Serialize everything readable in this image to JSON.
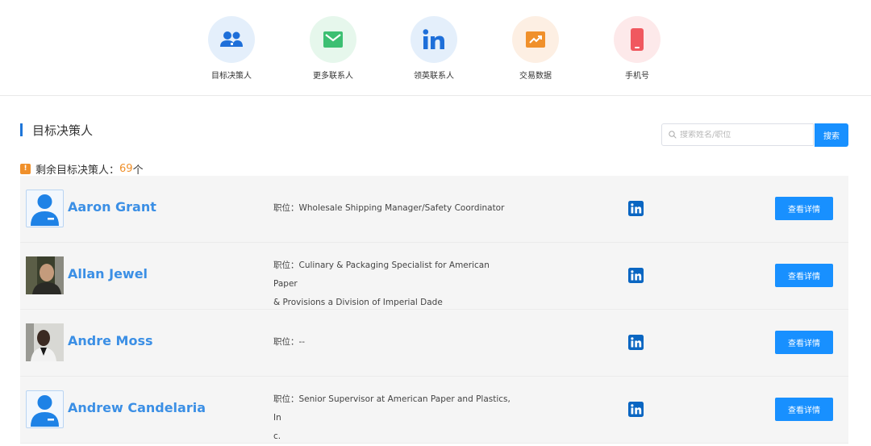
{
  "nav": {
    "items": [
      {
        "label": "目标决策人",
        "icon": "people-icon",
        "bg": "#e4effb"
      },
      {
        "label": "更多联系人",
        "icon": "mail-icon",
        "bg": "#e6f7ec"
      },
      {
        "label": "领英联系人",
        "icon": "linkedin-icon",
        "bg": "#e4effb"
      },
      {
        "label": "交易数据",
        "icon": "trend-chart-icon",
        "bg": "#fdefe3"
      },
      {
        "label": "手机号",
        "icon": "phone-icon",
        "bg": "#fde9ea"
      }
    ]
  },
  "section": {
    "title": "目标决策人"
  },
  "search": {
    "placeholder": "搜索姓名/职位",
    "button": "搜索"
  },
  "remaining": {
    "label": "剩余目标决策人：",
    "count": "69",
    "unit": "个"
  },
  "colors": {
    "accent": "#1890ff",
    "name": "#3b8fe5",
    "count": "#f0902b",
    "linkedin": "#0a66c2"
  },
  "people": [
    {
      "name": "Aaron Grant",
      "title_prefix": "职位：",
      "title": "Wholesale Shipping Manager/Safety Coordinator",
      "title_line2": "",
      "avatar": "default-avatar-icon",
      "button": "查看详情"
    },
    {
      "name": "Allan Jewel",
      "title_prefix": "职位：",
      "title": "Culinary & Packaging Specialist for American Paper",
      "title_line2": "& Provisions a Division of Imperial Dade",
      "avatar": "photo",
      "button": "查看详情"
    },
    {
      "name": "Andre Moss",
      "title_prefix": "职位：",
      "title": "--",
      "title_line2": "",
      "avatar": "photo",
      "button": "查看详情"
    },
    {
      "name": "Andrew Candelaria",
      "title_prefix": "职位：",
      "title": "Senior Supervisor at American Paper and Plastics, In",
      "title_line2": "c.",
      "avatar": "default-avatar-icon",
      "button": "查看详情"
    }
  ]
}
